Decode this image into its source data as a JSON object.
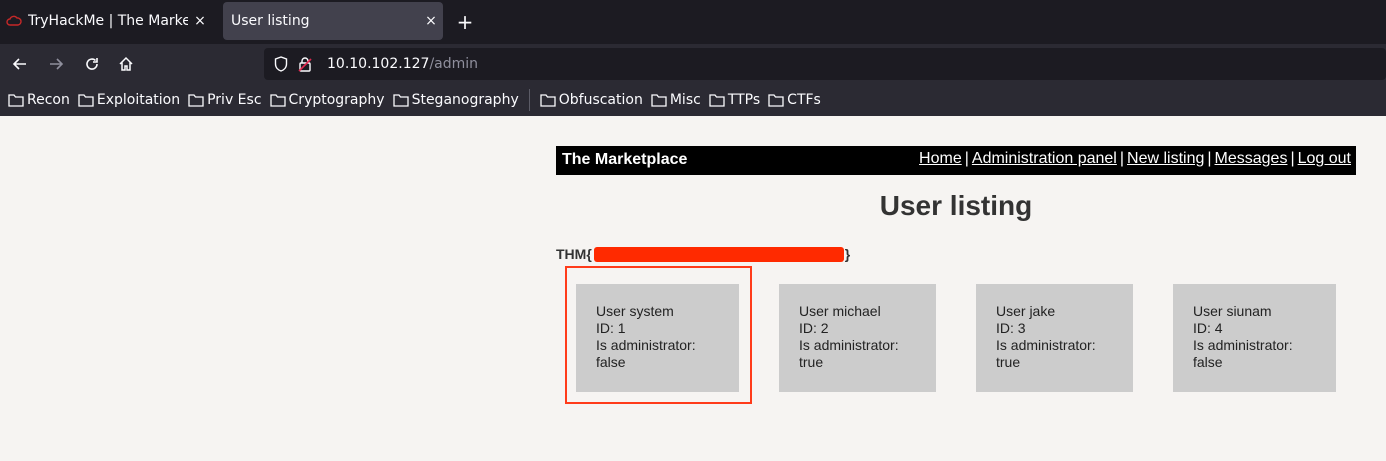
{
  "browser": {
    "tabs": [
      {
        "title": "TryHackMe | The Marketpl",
        "close": "×"
      },
      {
        "title": "User listing",
        "close": "×"
      }
    ],
    "new_tab": "+",
    "url_host": "10.10.102.127",
    "url_path": "/admin",
    "bookmarks": [
      "Recon",
      "Exploitation",
      "Priv Esc",
      "Cryptography",
      "Steganography",
      "Obfuscation",
      "Misc",
      "TTPs",
      "CTFs"
    ]
  },
  "site": {
    "name": "The Marketplace",
    "nav": [
      "Home",
      "Administration panel",
      "New listing",
      "Messages",
      "Log out"
    ],
    "nav_sep": "|"
  },
  "page": {
    "title": "User listing",
    "flag_prefix": "THM{",
    "flag_suffix": "}"
  },
  "users": [
    {
      "user": "User system",
      "id": "ID: 1",
      "admin_label": "Is administrator:",
      "admin_value": "false"
    },
    {
      "user": "User michael",
      "id": "ID: 2",
      "admin_label": "Is administrator:",
      "admin_value": "true"
    },
    {
      "user": "User jake",
      "id": "ID: 3",
      "admin_label": "Is administrator:",
      "admin_value": "true"
    },
    {
      "user": "User siunam",
      "id": "ID: 4",
      "admin_label": "Is administrator:",
      "admin_value": "false"
    }
  ],
  "colors": {
    "highlight": "#ff3b1a",
    "redaction": "#ff2a00",
    "card_bg": "#cccccc",
    "header_bg": "#000000"
  }
}
